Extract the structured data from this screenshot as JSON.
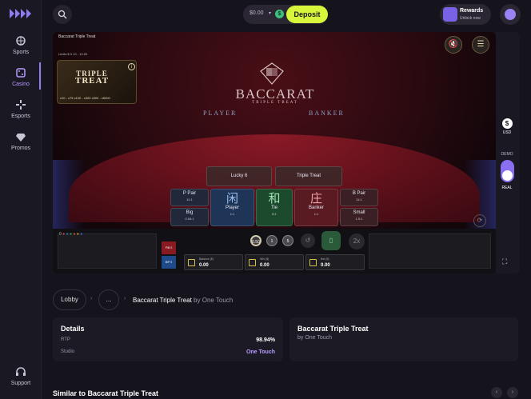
{
  "sidebar": {
    "items": [
      {
        "label": "Sports",
        "icon": "sports-icon"
      },
      {
        "label": "Casino",
        "icon": "casino-icon"
      },
      {
        "label": "Esports",
        "icon": "esports-icon"
      },
      {
        "label": "Promos",
        "icon": "gem-icon"
      }
    ],
    "support": "Support",
    "accent": "#8c7cf0"
  },
  "header": {
    "balance": "$0.00",
    "deposit": "Deposit",
    "rewards_title": "Rewards",
    "rewards_sub": "Unlock now",
    "accent": "#d6f53b"
  },
  "game": {
    "title": "Baccarat Triple Treat",
    "limits": "Limits $ 0.10 - 10.00",
    "promo": {
      "title_line1": "TRIPLE",
      "title_line2": "TREAT",
      "multipliers": "x10 - x75  x100 - x300  x500 - x5000"
    },
    "brand": "BACCARAT",
    "brand_sub": "TRIPLE TREAT",
    "player_label": "PLAYER",
    "banker_label": "BANKER",
    "bets": {
      "lucky6": "Lucky 6",
      "triple_treat": "Triple Treat",
      "p_pair": "P Pair",
      "p_pair_odds": "11:1",
      "b_pair": "B Pair",
      "b_pair_odds": "11:1",
      "big": "Big",
      "big_odds": "0.54:1",
      "small": "Small",
      "small_odds": "1.5:1",
      "player": "Player",
      "player_glyph": "闲",
      "player_odds": "1:1",
      "tie": "Tie",
      "tie_glyph": "和",
      "tie_odds": "8:1",
      "banker": "Banker",
      "banker_glyph": "庄",
      "banker_odds": "1:1"
    },
    "road_count": "0",
    "chips": [
      "0.50",
      "1",
      "5"
    ],
    "double": "2x",
    "balance_label": "Balance ($)",
    "balance_value": "0.00",
    "win_label": "Win ($)",
    "win_value": "0.00",
    "bet_label": "Bet ($)",
    "bet_value": "0.00",
    "tag_p": "P/B 0",
    "tag_b": "B/P 0"
  },
  "right_panel": {
    "currency": "USD",
    "demo": "DEMO",
    "real": "REAL"
  },
  "breadcrumb": {
    "lobby": "Lobby",
    "ellipsis": "...",
    "current": "Baccarat Triple Treat",
    "by": "by One Touch"
  },
  "details": {
    "heading": "Details",
    "rtp_label": "RTP",
    "rtp_value": "98.94%",
    "studio_label": "Studio",
    "studio_value": "One Touch",
    "studio_color": "#b79cff"
  },
  "game_card": {
    "title": "Baccarat Triple Treat",
    "by": "by One Touch"
  },
  "similar": "Similar to Baccarat Triple Treat"
}
